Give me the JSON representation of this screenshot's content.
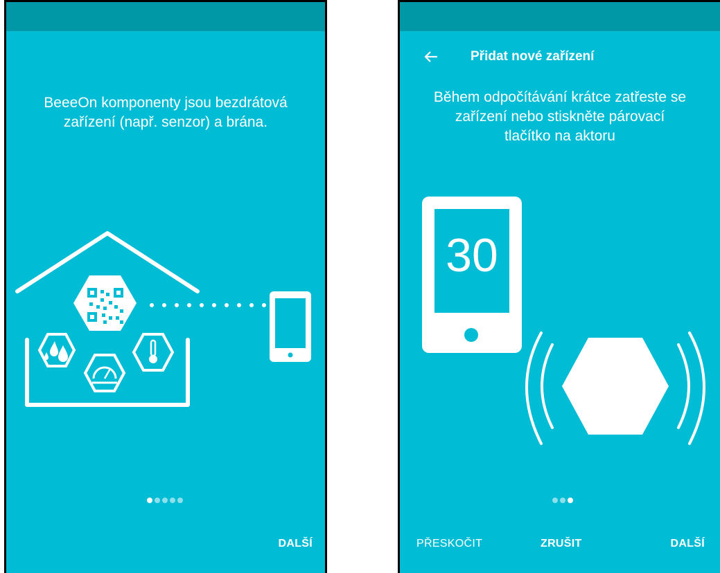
{
  "colors": {
    "accent": "#00bcd4",
    "status_bar": "#0097a7",
    "foreground": "#ffffff"
  },
  "left_screen": {
    "message": "BeeeOn komponenty jsou bezdrátová\nzařízení (např. senzor) a brána.",
    "pager": {
      "total": 5,
      "current": 1
    },
    "next_label": "DALŠÍ"
  },
  "right_screen": {
    "title": "Přidat nové zařízení",
    "back_icon": "arrow-back-icon",
    "message": "Během odpočítávání krátce zatřeste se\nzařízení nebo stiskněte párovací\ntlačítko na aktoru",
    "countdown": "30",
    "pager": {
      "total": 3,
      "current": 3
    },
    "skip_label": "PŘESKOČIT",
    "cancel_label": "ZRUŠIT",
    "next_label": "DALŠÍ"
  }
}
